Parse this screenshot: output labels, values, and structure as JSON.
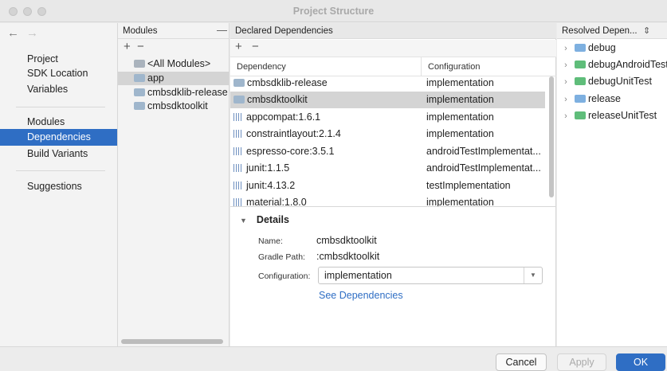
{
  "window": {
    "title": "Project Structure"
  },
  "nav": {
    "back_glyph": "←",
    "forward_glyph": "→",
    "items": [
      "Project",
      "SDK Location",
      "Variables",
      "Modules",
      "Dependencies",
      "Build Variants",
      "Suggestions"
    ],
    "selected": "Dependencies"
  },
  "modules": {
    "header": "Modules",
    "add_glyph": "+",
    "remove_glyph": "−",
    "collapse_glyph": "—",
    "items": [
      "<All Modules>",
      "app",
      "cmbsdklib-release",
      "cmbsdktoolkit"
    ],
    "selected": "app"
  },
  "dependencies": {
    "header": "Declared Dependencies",
    "add_glyph": "+",
    "remove_glyph": "−",
    "columns": {
      "dependency": "Dependency",
      "configuration": "Configuration"
    },
    "rows": [
      {
        "name": "cmbsdklib-release",
        "config": "implementation",
        "icon": "module-folder-icon"
      },
      {
        "name": "cmbsdktoolkit",
        "config": "implementation",
        "icon": "module-folder-icon"
      },
      {
        "name": "appcompat:1.6.1",
        "config": "implementation",
        "icon": "library-icon"
      },
      {
        "name": "constraintlayout:2.1.4",
        "config": "implementation",
        "icon": "library-icon"
      },
      {
        "name": "espresso-core:3.5.1",
        "config": "androidTestImplementat...",
        "icon": "library-icon"
      },
      {
        "name": "junit:1.1.5",
        "config": "androidTestImplementat...",
        "icon": "library-icon"
      },
      {
        "name": "junit:4.13.2",
        "config": "testImplementation",
        "icon": "library-icon"
      },
      {
        "name": "material:1.8.0",
        "config": "implementation",
        "icon": "library-icon"
      }
    ],
    "selected": "cmbsdktoolkit"
  },
  "details": {
    "title": "Details",
    "name_label": "Name:",
    "name_value": "cmbsdktoolkit",
    "gradle_path_label": "Gradle Path:",
    "gradle_path_value": ":cmbsdktoolkit",
    "configuration_label": "Configuration:",
    "configuration_value": "implementation",
    "link": "See Dependencies"
  },
  "resolved": {
    "header": "Resolved Depen...",
    "items": [
      {
        "label": "debug",
        "color": "#7eb0e0"
      },
      {
        "label": "debugAndroidTest",
        "color": "#5fbd7a"
      },
      {
        "label": "debugUnitTest",
        "color": "#5fbd7a"
      },
      {
        "label": "release",
        "color": "#7eb0e0"
      },
      {
        "label": "releaseUnitTest",
        "color": "#5fbd7a"
      }
    ]
  },
  "footer": {
    "cancel": "Cancel",
    "apply": "Apply",
    "ok": "OK"
  },
  "colors": {
    "accent": "#2f6ec4",
    "selection_gray": "#d4d4d4"
  }
}
